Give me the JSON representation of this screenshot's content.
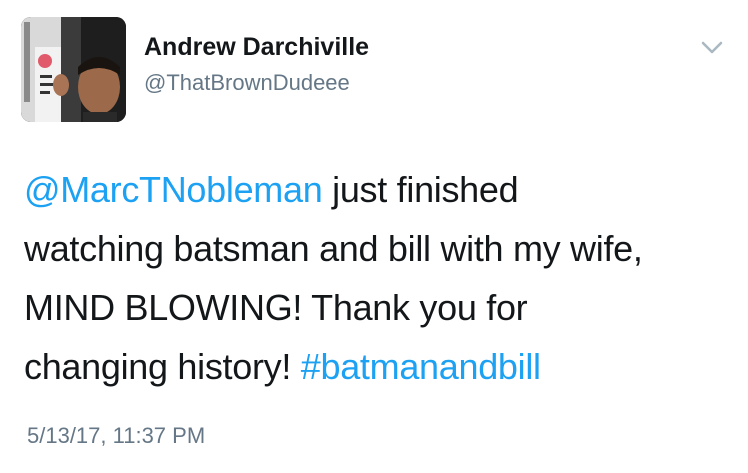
{
  "author": {
    "display_name": "Andrew Darchiville",
    "handle": "@ThatBrownDudeee",
    "avatar_icon": "profile-photo"
  },
  "menu": {
    "icon": "chevron-down-icon"
  },
  "tweet": {
    "line1_mention": "@MarcTNobleman",
    "line1_text": " just finished",
    "line2_text": "watching batsman and bill with my wife,",
    "line3_text": "MIND BLOWING! Thank you for",
    "line4_text": "changing history! ",
    "line4_hashtag": "#batmanandbill"
  },
  "meta": {
    "timestamp": "5/13/17, 11:37 PM"
  },
  "colors": {
    "link": "#1da1f2",
    "secondary_text": "#657786",
    "primary_text": "#14171a"
  }
}
